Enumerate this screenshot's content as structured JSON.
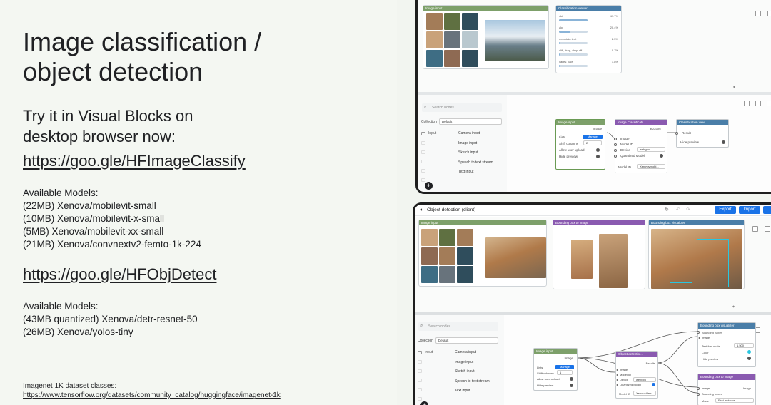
{
  "slide": {
    "title_line1": "Image classification /",
    "title_line2": "object detection",
    "subtitle_line1": "Try it in Visual Blocks on",
    "subtitle_line2": "desktop browser now:",
    "link_classify": "https://goo.gle/HFImageClassify",
    "classify_models_heading": "Available Models:",
    "classify_models": [
      "(22MB) Xenova/mobilevit-small",
      "(10MB) Xenova/mobilevit-x-small",
      "(5MB) Xenova/mobilevit-xx-small",
      "(21MB) Xenova/convnextv2-femto-1k-224"
    ],
    "link_detect": "https://goo.gle/HFObjDetect",
    "detect_models_heading": "Available Models:",
    "detect_models": [
      "(43MB quantized) Xenova/detr-resnet-50",
      "(26MB) Xenova/yolos-tiny"
    ],
    "footnote_label": "Imagenet 1K dataset classes:",
    "footnote_url": "https://www.tensorflow.org/datasets/community_catalog/huggingface/imagenet-1k"
  },
  "screen1": {
    "image_input_label": "Image input",
    "classification_label": "Classification viewer",
    "scores": [
      {
        "label": "ski",
        "value": "49.7%",
        "fraction": 0.5
      },
      {
        "label": "alp",
        "value": "20.4%",
        "fraction": 0.2
      },
      {
        "label": "mountain tent",
        "value": "2.5%",
        "fraction": 0.03
      },
      {
        "label": "cliff, drop, drop-off",
        "value": "0.7%",
        "fraction": 0.01
      },
      {
        "label": "valley, vale",
        "value": "1.8%",
        "fraction": 0.02
      }
    ],
    "search_placeholder": "Search nodes",
    "collection_label": "Collection",
    "collection_value": "Default",
    "nav_items": [
      "Input",
      "",
      "",
      "",
      "",
      ""
    ],
    "input_items": [
      "Camera input",
      "Image input",
      "Sketch input",
      "Speech to text stream",
      "Text input"
    ],
    "node_image_input": {
      "title": "Image input",
      "output": "Image",
      "rows": [
        "Lists",
        "Shift columns",
        "Allow user upload",
        "Hide preview"
      ],
      "manage": "Manage",
      "shift_value": "2"
    },
    "node_classifier": {
      "title": "Image Classificati...",
      "output": "Results",
      "rows": [
        "Image",
        "Model ID",
        "Device",
        "Quantized Model"
      ],
      "device_value": "webgpu",
      "model_id_label": "Model ID",
      "model_id_value": "Xenova/mobi..."
    },
    "node_viewer": {
      "title": "Classification view...",
      "rows": [
        "Result",
        "Hide preview"
      ]
    }
  },
  "screen2": {
    "title": "Object detection (client)",
    "buttons": [
      "Export",
      "Import",
      "Sh"
    ],
    "image_input_label": "Image input",
    "bbox_image_label": "Bounding box to image",
    "bbox_vis_label": "Bounding box visualizer",
    "search_placeholder": "Search nodes",
    "collection_label": "Collection",
    "collection_value": "Default",
    "nav_items": [
      "Input",
      "",
      "",
      "",
      "",
      ""
    ],
    "input_items": [
      "Camera input",
      "Image input",
      "Sketch input",
      "Speech to text stream",
      "Text input"
    ],
    "node_image_input": {
      "title": "Image input",
      "output": "Image",
      "rows": [
        "Lists",
        "Shift columns",
        "Allow user upload",
        "Hide preview"
      ],
      "manage": "Manage",
      "shift_value": "1"
    },
    "node_detector": {
      "title": "Object detectio...",
      "output": "Results",
      "rows": [
        "Image",
        "Model ID",
        "Device",
        "Quantized Model"
      ],
      "device_value": "webgpu",
      "model_id_label": "Model ID",
      "model_id_value": "Xenova/detr..."
    },
    "node_vis": {
      "title": "Bounding box visualizer",
      "rows": [
        "Bounding Boxes",
        "Image",
        "Text font scale",
        "Color",
        "Hide preview"
      ],
      "font_value": "1.500"
    },
    "node_bbox": {
      "title": "Bounding box to image",
      "output": "Image",
      "rows": [
        "Image",
        "Bounding boxes",
        "Mode"
      ],
      "mode_value": "First instance"
    }
  },
  "colors": {
    "image_header": "#7da06a",
    "process_header": "#8a5ab0",
    "output_header": "#4a7ea8",
    "accent": "#1a73e8"
  }
}
